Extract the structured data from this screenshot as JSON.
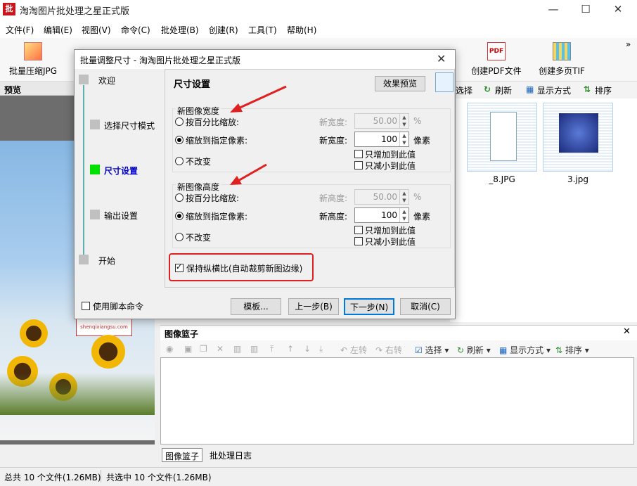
{
  "app": {
    "title": "淘淘图片批处理之星正式版",
    "icon_text": "批"
  },
  "window_controls": {
    "minimize": "—",
    "maximize": "☐",
    "close": "✕"
  },
  "menu": [
    "文件(F)",
    "编辑(E)",
    "视图(V)",
    "命令(C)",
    "批处理(B)",
    "创建(R)",
    "工具(T)",
    "帮助(H)"
  ],
  "toolbar": {
    "compress_jpg": "批量压缩JPG",
    "create_pdf": "创建PDF文件",
    "create_tif": "创建多页TIF",
    "pdf_icon_text": "PDF",
    "more": "»"
  },
  "preview": {
    "header": "预览",
    "watermark": "shenqixiangsu.com"
  },
  "right_toolbar": {
    "select": "选择",
    "refresh": "刷新",
    "display": "显示方式",
    "sort": "排序"
  },
  "thumbnails": [
    {
      "label": "_8.JPG"
    },
    {
      "label": "3.jpg"
    }
  ],
  "basket": {
    "header": "图像篮子",
    "close": "✕",
    "left_rotate": "左转",
    "right_rotate": "右转",
    "select": "选择",
    "refresh": "刷新",
    "display": "显示方式",
    "sort": "排序"
  },
  "basket_tabs": [
    "图像篮子",
    "批处理日志"
  ],
  "status": {
    "total": "总共 10 个文件(1.26MB)",
    "selected": "共选中 10 个文件(1.26MB)"
  },
  "dialog": {
    "title": "批量调整尺寸 - 淘淘图片批处理之星正式版",
    "close": "✕",
    "steps": [
      "欢迎",
      "选择尺寸模式",
      "尺寸设置",
      "输出设置",
      "开始"
    ],
    "active_step_color": "#00e000",
    "panel_title": "尺寸设置",
    "preview_button": "效果预览",
    "width_group": {
      "title": "新图像宽度",
      "opt_percent": "按百分比缩放:",
      "opt_pixels": "缩放到指定像素:",
      "opt_none": "不改变",
      "percent_label": "新宽度:",
      "percent_value": "50.00",
      "percent_unit": "%",
      "pixel_label": "新宽度:",
      "pixel_value": "100",
      "pixel_unit": "像素",
      "only_increase": "只增加到此值",
      "only_decrease": "只减小到此值"
    },
    "height_group": {
      "title": "新图像高度",
      "opt_percent": "按百分比缩放:",
      "opt_pixels": "缩放到指定像素:",
      "opt_none": "不改变",
      "percent_label": "新高度:",
      "percent_value": "50.00",
      "percent_unit": "%",
      "pixel_label": "新高度:",
      "pixel_value": "100",
      "pixel_unit": "像素",
      "only_increase": "只增加到此值",
      "only_decrease": "只减小到此值"
    },
    "keep_aspect": "保持纵横比(自动裁剪新图边缘)",
    "use_script": "使用脚本命令",
    "buttons": {
      "template": "模板...",
      "prev": "上一步(B)",
      "next": "下一步(N)",
      "cancel": "取消(C)"
    },
    "annotation_color": "#e02020"
  }
}
